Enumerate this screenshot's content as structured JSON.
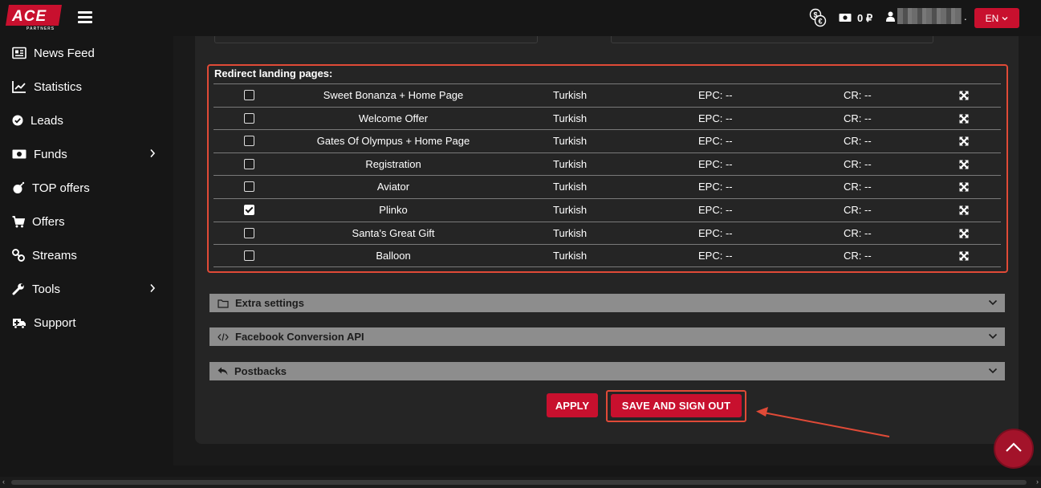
{
  "header": {
    "logo_text": "ACE",
    "logo_subtext": "PARTNERS",
    "balance": "0 ₽",
    "user_suffix": ".",
    "language": "EN"
  },
  "sidebar": {
    "items": [
      {
        "label": "News Feed",
        "icon": "newspaper-icon"
      },
      {
        "label": "Statistics",
        "icon": "chart-line-icon"
      },
      {
        "label": "Leads",
        "icon": "check-circle-icon"
      },
      {
        "label": "Funds",
        "icon": "money-icon",
        "has_submenu": true
      },
      {
        "label": "TOP offers",
        "icon": "bomb-icon"
      },
      {
        "label": "Offers",
        "icon": "cart-icon"
      },
      {
        "label": "Streams",
        "icon": "link-icon"
      },
      {
        "label": "Tools",
        "icon": "wrench-icon",
        "has_submenu": true
      },
      {
        "label": "Support",
        "icon": "ambulance-icon"
      }
    ]
  },
  "redirect": {
    "title": "Redirect landing pages:",
    "rows": [
      {
        "name": "Sweet Bonanza + Home Page",
        "language": "Turkish",
        "epc": "EPC: --",
        "cr": "CR: --",
        "checked": false
      },
      {
        "name": "Welcome Offer",
        "language": "Turkish",
        "epc": "EPC: --",
        "cr": "CR: --",
        "checked": false
      },
      {
        "name": "Gates Of Olympus + Home Page",
        "language": "Turkish",
        "epc": "EPC: --",
        "cr": "CR: --",
        "checked": false
      },
      {
        "name": "Registration",
        "language": "Turkish",
        "epc": "EPC: --",
        "cr": "CR: --",
        "checked": false
      },
      {
        "name": "Aviator",
        "language": "Turkish",
        "epc": "EPC: --",
        "cr": "CR: --",
        "checked": false
      },
      {
        "name": "Plinko",
        "language": "Turkish",
        "epc": "EPC: --",
        "cr": "CR: --",
        "checked": true
      },
      {
        "name": "Santa's Great Gift",
        "language": "Turkish",
        "epc": "EPC: --",
        "cr": "CR: --",
        "checked": false
      },
      {
        "name": "Balloon",
        "language": "Turkish",
        "epc": "EPC: --",
        "cr": "CR: --",
        "checked": false
      }
    ]
  },
  "accordions": {
    "extra": "Extra settings",
    "facebook": "Facebook Conversion API",
    "postbacks": "Postbacks"
  },
  "actions": {
    "apply": "APPLY",
    "save_sign_out": "SAVE AND SIGN OUT"
  },
  "colors": {
    "accent": "#c8102e",
    "highlight": "#e04a37",
    "accordion": "#8d8d8d"
  }
}
